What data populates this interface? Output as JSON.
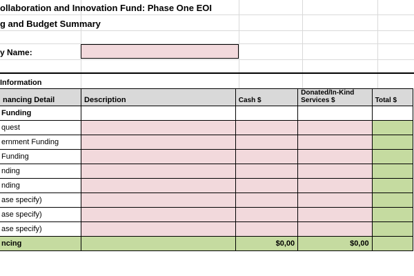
{
  "sheet": {
    "title": "ollaboration and Innovation Fund: Phase One EOI",
    "subtitle": "g and Budget Summary",
    "entity_name_label": "y Name:",
    "section_label": " Information"
  },
  "table": {
    "headers": {
      "col1": "nancing Detail",
      "col2": "Description",
      "col3": "Cash $",
      "col4": "Donated/In-Kind Services $",
      "col5": "Total $"
    },
    "rows": [
      {
        "label": " Funding",
        "style": "subheading"
      },
      {
        "label": "quest",
        "style": "entry"
      },
      {
        "label": "ernment Funding",
        "style": "entry"
      },
      {
        "label": " Funding",
        "style": "entry"
      },
      {
        "label": "nding",
        "style": "entry"
      },
      {
        "label": "nding",
        "style": "entry"
      },
      {
        "label": "ase specify)",
        "style": "entry"
      },
      {
        "label": "ase specify)",
        "style": "entry"
      },
      {
        "label": "ase specify)",
        "style": "entry"
      }
    ],
    "total_row": {
      "label": "ncing",
      "cash": "$0,00",
      "in_kind": "$0,00"
    }
  },
  "colors": {
    "pink_input": "#f2d9dc",
    "green_total": "#c5dba0",
    "header_grey": "#d9d9d9"
  }
}
